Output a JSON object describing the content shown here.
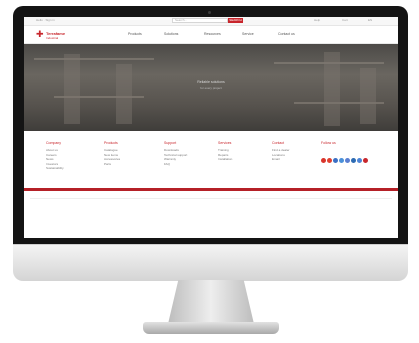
{
  "topbar": {
    "left_text": "Hello · Sign in",
    "search_placeholder": "Search...",
    "search_button": "SEARCH",
    "right_items": [
      "Help",
      "Cart",
      "EN"
    ]
  },
  "header": {
    "logo_name": "Terrafame",
    "logo_tagline": "Industrial",
    "logo_mark": "✚",
    "nav": [
      "Products",
      "Solutions",
      "Resources",
      "Service",
      "Contact us"
    ]
  },
  "hero": {
    "title": "Reliable solutions",
    "subtitle": "for every project"
  },
  "footer": {
    "columns": [
      {
        "heading": "Company",
        "items": [
          "About us",
          "Careers",
          "News",
          "Investors",
          "Sustainability"
        ]
      },
      {
        "heading": "Products",
        "items": [
          "Catalogue",
          "New items",
          "Accessories",
          "Parts"
        ]
      },
      {
        "heading": "Support",
        "items": [
          "Downloads",
          "Technical support",
          "Warranty",
          "FAQ"
        ]
      },
      {
        "heading": "Services",
        "items": [
          "Training",
          "Repairs",
          "Installation"
        ]
      },
      {
        "heading": "Contact",
        "items": [
          "Find a dealer",
          "Locations",
          "Email"
        ]
      }
    ],
    "social_heading": "Follow us",
    "social": [
      {
        "name": "facebook-icon",
        "color": "#d9352b"
      },
      {
        "name": "twitter-icon",
        "color": "#e0402f"
      },
      {
        "name": "linkedin-icon",
        "color": "#3b6fc4"
      },
      {
        "name": "youtube-icon",
        "color": "#4a90d9"
      },
      {
        "name": "instagram-icon",
        "color": "#5b7fd1"
      },
      {
        "name": "pinterest-icon",
        "color": "#2d6bb3"
      },
      {
        "name": "rss-icon",
        "color": "#4d85d6"
      },
      {
        "name": "mail-icon",
        "color": "#c8262c"
      }
    ]
  },
  "colors": {
    "accent": "#c8262c",
    "footer_bar": "#b52027"
  }
}
